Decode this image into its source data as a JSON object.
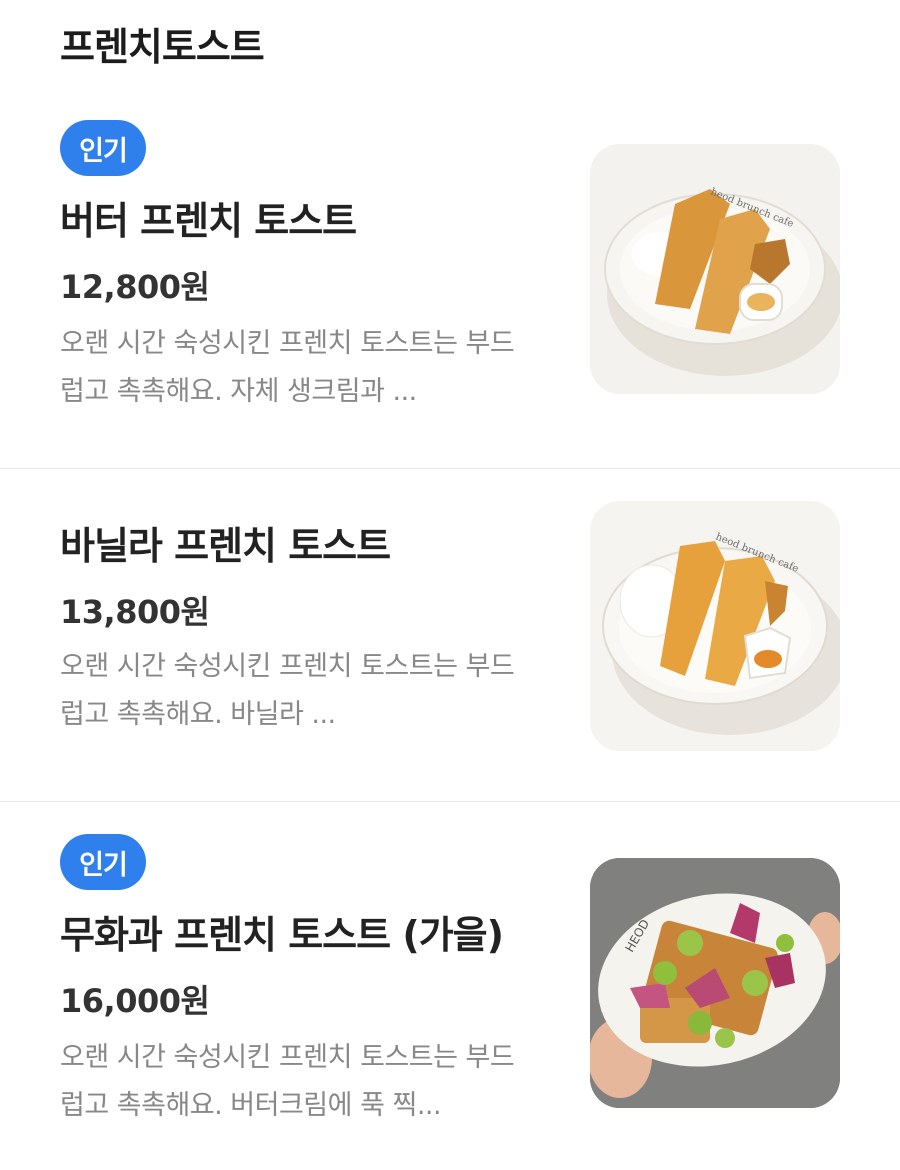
{
  "section": {
    "title": "프렌치토스트"
  },
  "items": [
    {
      "badge": "인기",
      "name": "버터 프렌치 토스트",
      "price": "12,800원",
      "description": "오랜 시간 숙성시킨 프렌치 토스트는 부드럽고 촉촉해요. 자체 생크림과 ...",
      "image": "butter-french-toast-photo",
      "plate_text": "heod brunch cafe"
    },
    {
      "badge": "",
      "name": "바닐라 프렌치 토스트",
      "price": "13,800원",
      "description": "오랜 시간 숙성시킨 프렌치 토스트는 부드럽고 촉촉해요. 바닐라 ...",
      "image": "vanilla-french-toast-photo",
      "plate_text": "heod brunch cafe"
    },
    {
      "badge": "인기",
      "name": "무화과 프렌치 토스트 (가을)",
      "price": "16,000원",
      "description": "오랜 시간 숙성시킨 프렌치 토스트는 부드럽고 촉촉해요. 버터크림에 푹 찍...",
      "image": "fig-french-toast-photo",
      "plate_text": "HEOD"
    }
  ],
  "colors": {
    "badge": "#2f80ed",
    "price": "#333333",
    "description": "#888888",
    "divider": "#e9e9e9"
  }
}
